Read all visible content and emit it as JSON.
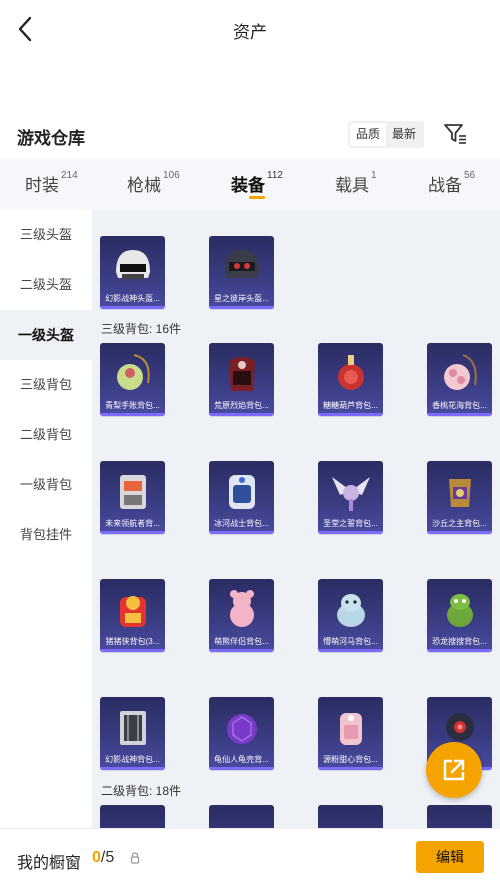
{
  "topbar": {
    "title": "资产",
    "back_icon": "chevron-left-icon"
  },
  "header": {
    "title": "游戏仓库",
    "sort_options": [
      "品质",
      "最新"
    ],
    "active_sort": "品质",
    "filter_icon": "filter-icon"
  },
  "tabs": [
    {
      "label": "时装",
      "count": "214"
    },
    {
      "label": "枪械",
      "count": "106"
    },
    {
      "label": "装备",
      "count": "112"
    },
    {
      "label": "载具",
      "count": "1"
    },
    {
      "label": "战备",
      "count": "56"
    }
  ],
  "active_tab": "装备",
  "sidebar": {
    "items": [
      "三级头盔",
      "二级头盔",
      "一级头盔",
      "三级背包",
      "二级背包",
      "一级背包",
      "背包挂件"
    ],
    "active": "一级头盔"
  },
  "sections": [
    {
      "label": "",
      "items": [
        "幻影战神头盔...",
        "星之彼岸头盔..."
      ]
    },
    {
      "label": "三级背包: 16件",
      "items": [
        "青梨手账背包...",
        "荒原烈焰背包...",
        "糖糖葫芦背包...",
        "香桃花海背包...",
        "未来领航者背...",
        "冰河战士背包...",
        "圣堂之誓背包...",
        "沙丘之主背包...",
        "猪猪侠背包(3...",
        "萌熊伴侣背包...",
        "懵萌河马背包...",
        "恐龙搜搜背包...",
        "幻影战神背包...",
        "龟仙人龟壳背...",
        "源粉甜心背包...",
        ""
      ]
    },
    {
      "label": "二级背包: 18件",
      "items": [
        "",
        "",
        "",
        ""
      ]
    }
  ],
  "colors": {
    "accent": "#f5a300",
    "card_bg": "#2a2c62",
    "card_stripe": "#7b6cff",
    "content_bg": "#eef1f5"
  },
  "fab": {
    "icon": "share-external-icon"
  },
  "bottom": {
    "label": "我的橱窗",
    "current": "0",
    "total": "/5",
    "lock_icon": "lock-icon",
    "edit_label": "编辑"
  }
}
